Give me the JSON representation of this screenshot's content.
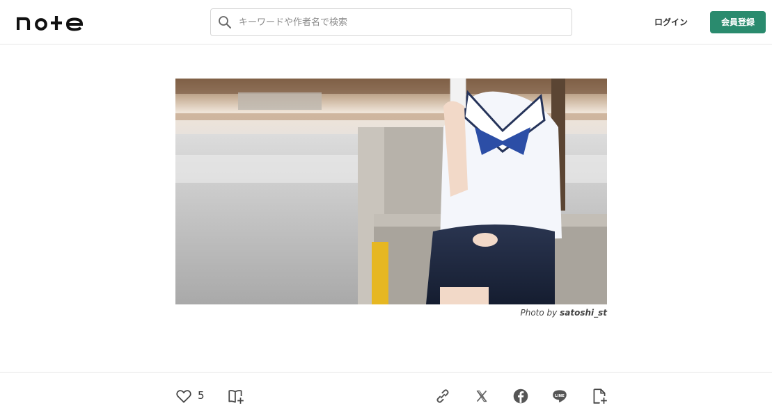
{
  "header": {
    "logo_text": "note",
    "search_placeholder": "キーワードや作者名で検索",
    "login_label": "ログイン",
    "signup_label": "会員登録"
  },
  "hero": {
    "photo_credit_prefix": "Photo by",
    "photo_credit_author": "satoshi_st"
  },
  "actions": {
    "like_count": "5",
    "icons": [
      "heart-icon",
      "magazine-add-icon",
      "link-icon",
      "x-icon",
      "facebook-icon",
      "line-icon",
      "note-add-icon"
    ]
  },
  "colors": {
    "accent": "#2a8b6e",
    "border": "#e6e6e6"
  }
}
